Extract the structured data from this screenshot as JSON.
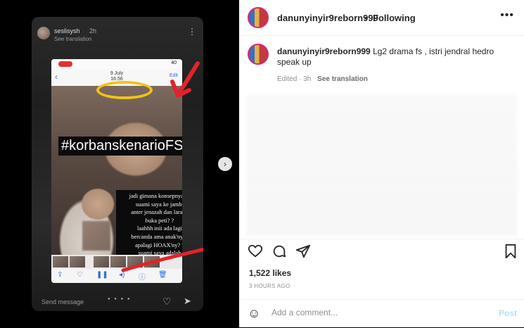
{
  "story": {
    "username": "seslisysh",
    "time": "2h",
    "see_translation": "See translation",
    "battery": "40",
    "date_line1": "9 July",
    "date_line2": "16.56",
    "edit_label": "Edit",
    "hashtag": "#korbanskenarioFS",
    "caption": "jadi gimana konsepnya? ?\nsuami saya ke jambi\nanter jenazah dan larang\nbuka peti? ?\nlaahhh inii ada lagi\nbercanda ama anak'ny :)\napalagi HOAX'ny? ?\nsuami saya adalah\nKORBAN dari skenario\nPak FS sama seperti\nbanyaknya anggota lain\nyang di periksa",
    "send_message": "Send message"
  },
  "post": {
    "header_username": "danunyinyir9reborn999",
    "following_label": "Following",
    "caption_username": "danunyinyir9reborn999",
    "caption_text": "Lg2 drama fs , istri jendral hedro speak up",
    "edited_time": "Edited · 3h",
    "see_translation": "See translation",
    "likes": "1,522 likes",
    "time_ago": "3 HOURS AGO",
    "comment_placeholder": "Add a comment...",
    "post_label": "Post"
  },
  "icons": {
    "next": "chevron-right-icon",
    "more": "more-horizontal-icon",
    "like": "heart-icon",
    "comment": "comment-icon",
    "share": "send-icon",
    "save": "bookmark-icon",
    "emoji": "emoji-icon"
  },
  "colors": {
    "story_ring": "#d62976",
    "link_blue": "#b2dffc"
  }
}
